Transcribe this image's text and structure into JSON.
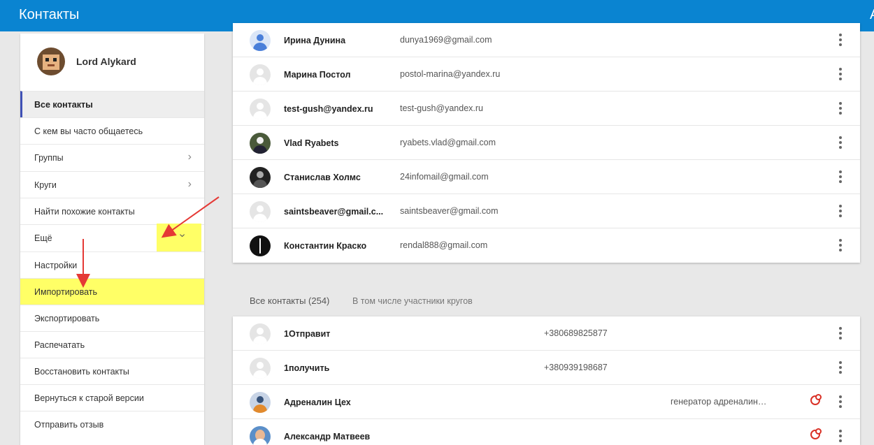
{
  "app": {
    "title": "Контакты",
    "edge_text": "А"
  },
  "user": {
    "name": "Lord Alykard"
  },
  "sidebar": {
    "items": [
      {
        "label": "Все контакты",
        "active": true
      },
      {
        "label": "С кем вы часто общаетесь"
      },
      {
        "label": "Группы",
        "chevron": "chevron-right"
      },
      {
        "label": "Круги",
        "chevron": "chevron-right"
      },
      {
        "label": "Найти похожие контакты"
      },
      {
        "label": "Ещё",
        "chevron": "chevron-down"
      },
      {
        "label": "Настройки"
      },
      {
        "label": "Импортировать",
        "highlighted": true
      },
      {
        "label": "Экспортировать"
      },
      {
        "label": "Распечатать"
      },
      {
        "label": "Восстановить контакты"
      },
      {
        "label": "Вернуться к старой версии"
      },
      {
        "label": "Отправить отзыв"
      }
    ]
  },
  "frequent_contacts": [
    {
      "name": "Ирина Дунина",
      "email": "dunya1969@gmail.com",
      "avatar": "default-blue"
    },
    {
      "name": "Марина Постол",
      "email": "postol-marina@yandex.ru",
      "avatar": "default"
    },
    {
      "name": "test-gush@yandex.ru",
      "email": "test-gush@yandex.ru",
      "avatar": "default"
    },
    {
      "name": "Vlad Ryabets",
      "email": "ryabets.vlad@gmail.com",
      "avatar": "photo"
    },
    {
      "name": "Станислав Холмс",
      "email": "24infomail@gmail.com",
      "avatar": "photo"
    },
    {
      "name": "saintsbeaver@gmail.c...",
      "email": "saintsbeaver@gmail.com",
      "avatar": "default"
    },
    {
      "name": "Константин Краско",
      "email": "rendal888@gmail.com",
      "avatar": "photo"
    }
  ],
  "all_contacts": {
    "header": "Все контакты (254)",
    "subheader": "В том числе участники кругов",
    "rows": [
      {
        "name": "1Отправит",
        "phone": "+380689825877",
        "group": "",
        "avatar": "default"
      },
      {
        "name": "1получить",
        "phone": "+380939198687",
        "group": "",
        "avatar": "default"
      },
      {
        "name": "Адреналин Цех",
        "phone": "",
        "group": "генератор адреналин…",
        "avatar": "photo",
        "circle_icon": true
      },
      {
        "name": "Александр Матвеев",
        "phone": "",
        "group": "",
        "avatar": "photo",
        "circle_icon": true
      }
    ]
  },
  "colors": {
    "topbar": "#0a84d1",
    "highlight": "#ffff66",
    "active_accent": "#3f51b5",
    "arrow": "#e53935"
  }
}
